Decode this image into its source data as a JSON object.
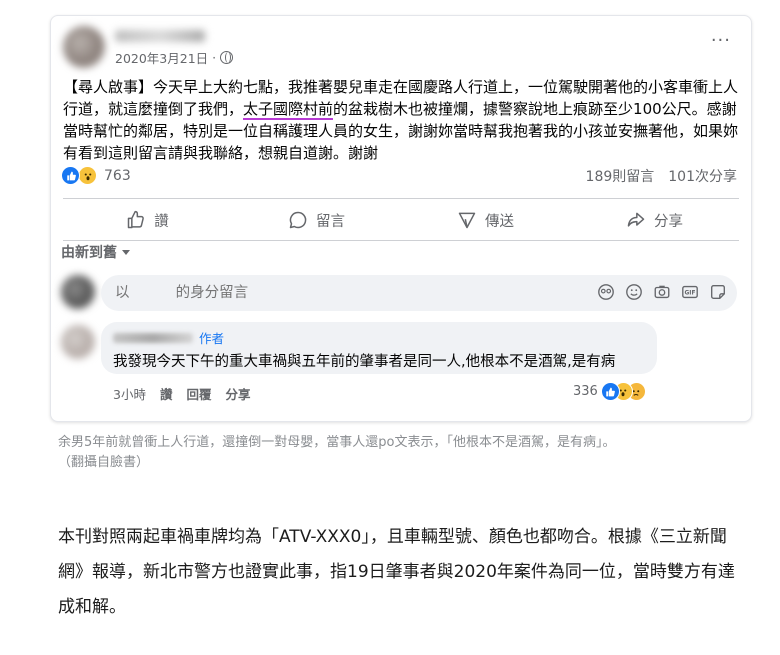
{
  "post": {
    "date": "2020年3月21日",
    "more_label": "···",
    "text_before": "【尋人啟事】今天早上大約七點，我推著嬰兒車走在國慶路人行道上，一位駕駛開著他的小客車衝上人行道，就這麼撞倒了我們，",
    "text_underlined": "太子國際村前",
    "text_after": "的盆栽樹木也被撞爛，據警察說地上痕跡至少100公尺。感謝當時幫忙的鄰居，特別是一位自稱護理人員的女生，謝謝妳當時幫我抱著我的小孩並安撫著他，如果妳有看到這則留言請與我聯絡，想親自道謝。謝謝",
    "reaction_count": "763",
    "comment_count": "189則留言",
    "share_count": "101次分享"
  },
  "actions": {
    "like": "讚",
    "comment": "留言",
    "send": "傳送",
    "share": "分享"
  },
  "sort_label": "由新到舊",
  "comment_input": {
    "placeholder": "以          的身分留言"
  },
  "comment": {
    "author_badge": "作者",
    "text": "我發現今天下午的重大車禍與五年前的肇事者是同一人,他根本不是酒駕,是有病",
    "time": "3小時",
    "like": "讚",
    "reply": "回覆",
    "share": "分享",
    "reaction_count": "336"
  },
  "caption": {
    "line1": "余男5年前就曾衝上人行道，還撞倒一對母嬰，當事人還po文表示，「他根本不是酒駕，是有病」。",
    "line2": "（翻攝自臉書）"
  },
  "article": "本刊對照兩起車禍車牌均為「ATV-XXX0」，且車輛型號、顏色也都吻合。根據《三立新聞網》報導，新北市警方也證實此事，指19日肇事者與2020年案件為同一位，當時雙方有達成和解。",
  "colors": {
    "facebook_blue": "#1877f2",
    "secondary_text": "#65676b",
    "underline": "#b83bd4"
  },
  "icons": [
    "globe-icon",
    "more-icon",
    "like-icon",
    "comment-icon",
    "send-icon",
    "share-icon",
    "caret-down-icon",
    "sticker-emoji-icon",
    "emoji-icon",
    "camera-icon",
    "gif-icon",
    "sticker-icon",
    "like-reaction-icon",
    "wow-reaction-icon",
    "sad-reaction-icon"
  ]
}
